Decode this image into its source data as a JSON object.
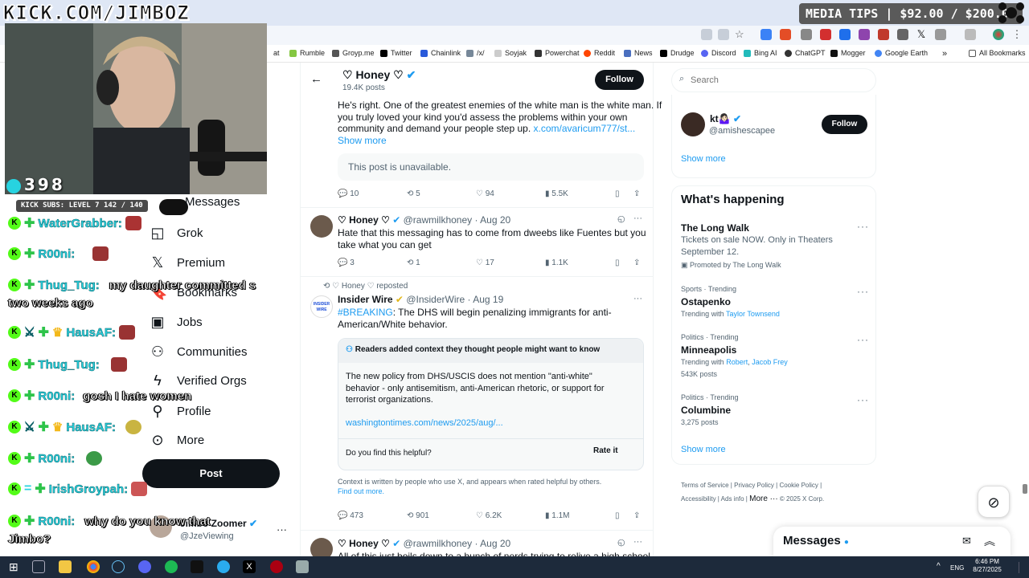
{
  "stream": {
    "watermark": "KICK.COM/JIMBOZ",
    "tips": "MEDIA TIPS | $92.00 / $200.00",
    "viewers": "398",
    "subs_bar": "KICK SUBS: LEVEL 7 142 / 140"
  },
  "bookmarks": [
    {
      "label": "at",
      "icon": "clipped-bookmark-icon"
    },
    {
      "label": "Rumble",
      "icon": "rumble-icon"
    },
    {
      "label": "Groyp.me",
      "icon": "groyp-icon"
    },
    {
      "label": "Twitter",
      "icon": "x-icon"
    },
    {
      "label": "Chainlink",
      "icon": "chainlink-icon"
    },
    {
      "label": "/x/",
      "icon": "slash-icon"
    },
    {
      "label": "Soyjak",
      "icon": "soyjak-icon"
    },
    {
      "label": "Powerchat",
      "icon": "powerchat-icon"
    },
    {
      "label": "Reddit",
      "icon": "reddit-icon"
    },
    {
      "label": "News",
      "icon": "news-icon"
    },
    {
      "label": "Drudge",
      "icon": "drudge-icon"
    },
    {
      "label": "Discord",
      "icon": "discord-icon"
    },
    {
      "label": "Bing AI",
      "icon": "bing-icon"
    },
    {
      "label": "ChatGPT",
      "icon": "chatgpt-icon"
    },
    {
      "label": "Mogger",
      "icon": "mogger-icon"
    },
    {
      "label": "Google Earth",
      "icon": "google-earth-icon"
    },
    {
      "label": "All Bookmarks",
      "icon": "folder-icon"
    }
  ],
  "nav": {
    "messages": "Messages",
    "grok": "Grok",
    "premium": "Premium",
    "bookmarks": "Bookmarks",
    "jobs": "Jobs",
    "communities": "Communities",
    "verified_orgs": "Verified Orgs",
    "profile": "Profile",
    "more": "More",
    "post": "Post",
    "account_name": "Jimbo Zoomer",
    "account_handle": "@JzeViewing"
  },
  "chat": [
    {
      "user": "WaterGrabber:",
      "msg": ""
    },
    {
      "user": "R00ni:",
      "msg": ""
    },
    {
      "user": "Thug_Tug:",
      "msg": "my daughter committed s"
    },
    {
      "user": "",
      "msg": "two weeks ago"
    },
    {
      "user": "HausAF:",
      "msg": ""
    },
    {
      "user": "Thug_Tug:",
      "msg": ""
    },
    {
      "user": "R00ni:",
      "msg": "gosh I hate women"
    },
    {
      "user": "HausAF:",
      "msg": ""
    },
    {
      "user": "R00ni:",
      "msg": ""
    },
    {
      "user": "IrishGroypah:",
      "msg": ""
    },
    {
      "user": "R00ni:",
      "msg": "why do you know that"
    },
    {
      "user": "",
      "msg": "Jimbo?"
    }
  ],
  "header": {
    "name": "♡ Honey ♡",
    "posts": "19.4K posts",
    "follow": "Follow"
  },
  "tweet1": {
    "text1": "He's right. One of the greatest enemies of the white man is the white man. If",
    "text2": "you truly loved your kind you'd assess the problems within your own",
    "text3": "community and demand your people step up.",
    "link": "x.com/avaricum777/st...",
    "show_more": "Show more",
    "unavailable": "This post is unavailable.",
    "replies": "10",
    "reposts": "5",
    "likes": "94",
    "views": "5.5K"
  },
  "tweet2": {
    "name": "♡ Honey ♡",
    "handle": "@rawmilkhoney",
    "date": "· Aug 20",
    "text1": "Hate that this messaging has to come from dweebs like Fuentes but you",
    "text2": "take what you can get",
    "replies": "3",
    "reposts": "1",
    "likes": "17",
    "views": "1.1K"
  },
  "tweet3": {
    "repost_label": "♡ Honey ♡ reposted",
    "name": "Insider Wire",
    "handle": "@InsiderWire",
    "date": "· Aug 19",
    "avatar_text": "INSIDER WIRE",
    "hashtag": "#BREAKING",
    "text1": ": The DHS will begin penalizing immigrants for anti-",
    "text2": "American/White behavior.",
    "note_title": "Readers added context they thought people might want to know",
    "note1": "The new policy from DHS/USCIS does not mention \"anti-white\"",
    "note2": "behavior - only antisemitism, anti-American rhetoric, or support for",
    "note3": "terrorist organizations.",
    "note_link": "washingtontimes.com/news/2025/aug/...",
    "helpful_q": "Do you find this helpful?",
    "rate": "Rate it",
    "disclaimer1": "Context is written by people who use X, and appears when rated helpful by others.",
    "find_out": "Find out more.",
    "replies": "473",
    "reposts": "901",
    "likes": "6.2K",
    "views": "1.1M"
  },
  "tweet4": {
    "name": "♡ Honey ♡",
    "handle": "@rawmilkhoney",
    "date": "· Aug 20",
    "text1": "All of this just boils down to a bunch of nerds trying to relive a high school"
  },
  "right": {
    "search_placeholder": "Search",
    "suggest_name": "kt🤷🏻‍♀️",
    "suggest_handle": "@amishescapee",
    "follow": "Follow",
    "show_more1": "Show more",
    "happening": "What's happening",
    "t1_title": "The Long Walk",
    "t1_desc1": "Tickets on sale NOW. Only in Theaters",
    "t1_desc2": "September 12.",
    "t1_promo": "Promoted by The Long Walk",
    "t2_cat": "Sports · Trending",
    "t2_title": "Ostapenko",
    "t2_with": "Trending with",
    "t2_link": "Taylor Townsend",
    "t3_cat": "Politics · Trending",
    "t3_title": "Minneapolis",
    "t3_with": "Trending with",
    "t3_link1": "Robert",
    "t3_link2": "Jacob Frey",
    "t3_posts": "543K posts",
    "t4_cat": "Politics · Trending",
    "t4_title": "Columbine",
    "t4_posts": "3,275 posts",
    "show_more2": "Show more",
    "footer": [
      "Terms of Service",
      "Privacy Policy",
      "Cookie Policy",
      "Accessibility",
      "Ads info",
      "More ···",
      "© 2025 X Corp."
    ],
    "messages": "Messages"
  },
  "taskbar": {
    "lang": "ENG",
    "time": "6:46 PM",
    "date": "8/27/2025"
  },
  "colors": {
    "accent": "#1d9bf0",
    "chat_user": "#27d3e0",
    "kick_green": "#53fc18",
    "taskbar": "#1d2a3b"
  }
}
